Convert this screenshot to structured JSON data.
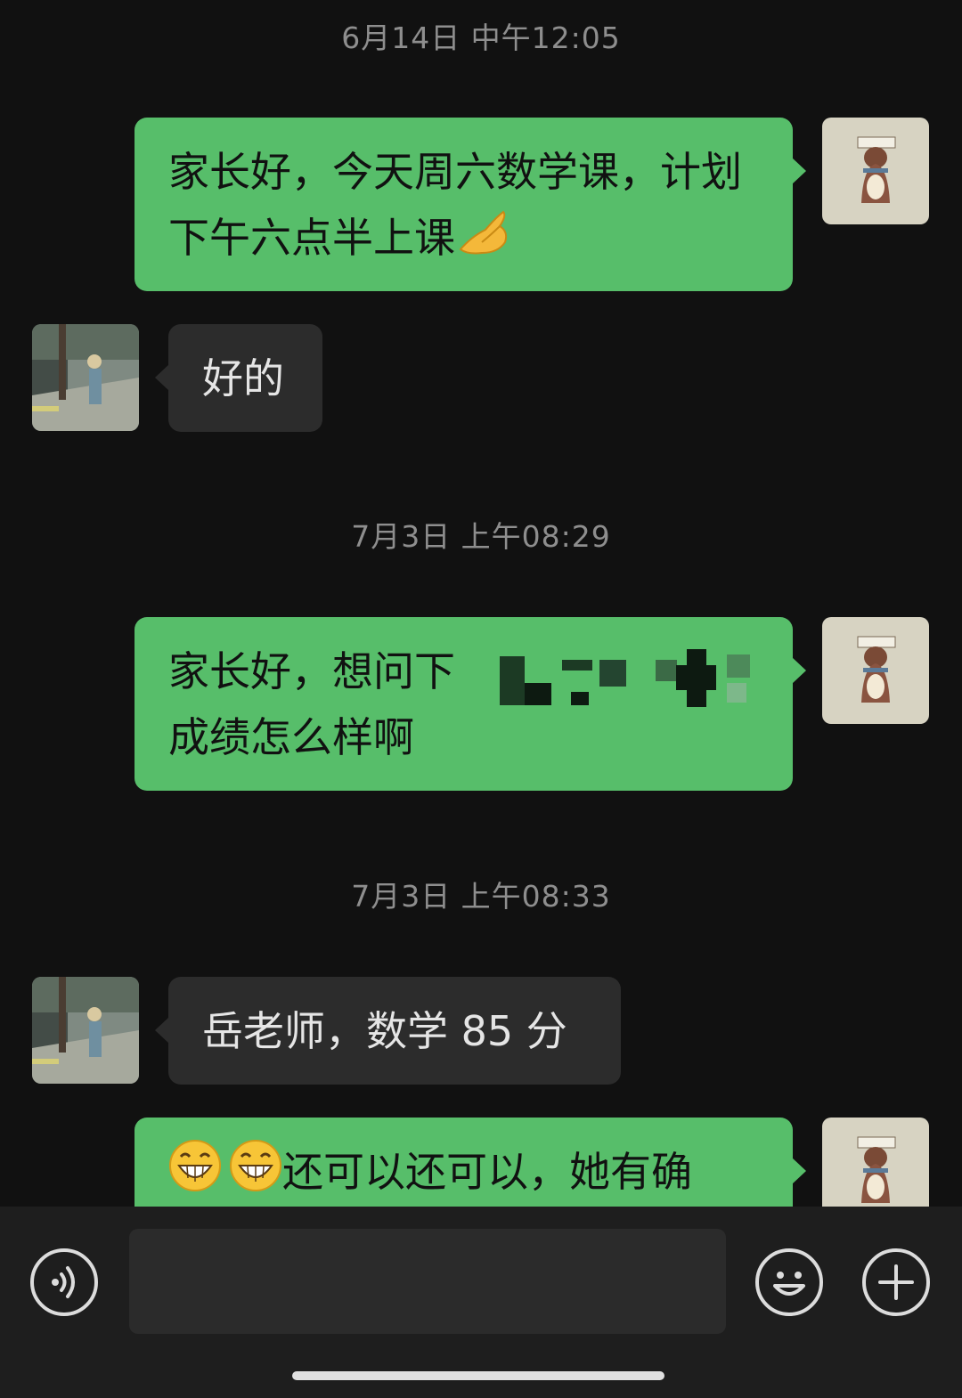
{
  "messages": [
    {
      "type": "timestamp",
      "text": "6月14日 中午12:05"
    },
    {
      "type": "sent",
      "text": "家长好，今天周六数学课，计划下午六点半上课",
      "emoji": "pinched-hand-emoji"
    },
    {
      "type": "received",
      "text": "好的"
    },
    {
      "type": "timestamp",
      "text": "7月3日 上午08:29"
    },
    {
      "type": "sent",
      "line1": "家长好，想问下",
      "line2": "成绩怎么样啊",
      "note": "partially pixelated"
    },
    {
      "type": "timestamp",
      "text": "7月3日 上午08:33"
    },
    {
      "type": "received",
      "text": "岳老师，数学 85 分"
    },
    {
      "type": "sent",
      "text": "还可以还可以，她有确",
      "emoji": "grinning-face-emoji x2"
    }
  ],
  "input_bar": {
    "voice_icon": "voice-icon",
    "emoji_icon": "smiley-icon",
    "plus_icon": "plus-icon",
    "input_value": ""
  },
  "colors": {
    "background": "#111111",
    "sent_bubble": "#57be6a",
    "received_bubble": "#2c2c2c",
    "timestamp": "#8e8e8e",
    "bottom_bar": "#1e1e1e"
  }
}
